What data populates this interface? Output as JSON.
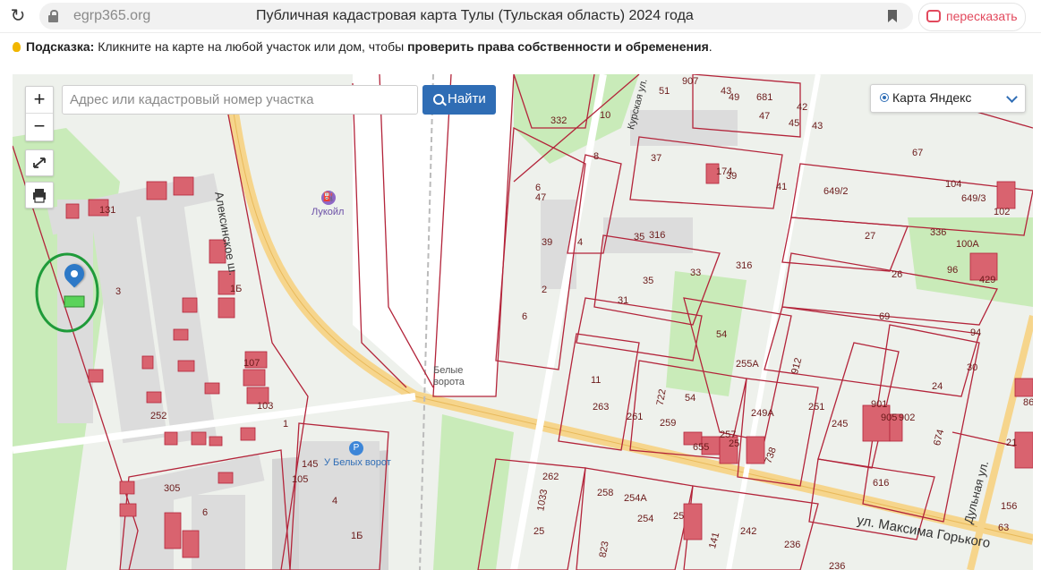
{
  "browser": {
    "domain": "egrp365.org",
    "page_title": "Публичная кадастровая карта Тулы (Тульская область) 2024 года",
    "retell_label": "пересказать"
  },
  "hint": {
    "label": "Подсказка:",
    "text": "Кликните на карте на любой участок или дом, чтобы",
    "bold": "проверить права собственности и обременения",
    "end": "."
  },
  "map": {
    "search_placeholder": "Адрес или кадастровый номер участка",
    "find_label": "Найти",
    "layer_label": "Карта Яндекс",
    "zoom_in": "+",
    "zoom_out": "−",
    "streets": {
      "aleksinskoe": "Алексинское ш.",
      "kurskaya": "Курская ул.",
      "maxim_gorkogo": "ул. Максима Горького",
      "dulnaya": "Дульная ул."
    },
    "pois": {
      "lukoil": "Лукойл",
      "belye_vorota": "Белые ворота",
      "u_belyh_vorot": "У Белых ворот"
    },
    "parcels": [
      "332",
      "10",
      "51",
      "907",
      "43",
      "49",
      "681",
      "47",
      "42",
      "45",
      "43",
      "67",
      "8",
      "37",
      "174",
      "39",
      "41",
      "649/2",
      "104",
      "649/3",
      "102",
      "6",
      "47",
      "131",
      "35",
      "316",
      "27",
      "336",
      "100А",
      "39",
      "4",
      "1Б",
      "3",
      "316",
      "26",
      "96",
      "429",
      "35",
      "33",
      "2",
      "31",
      "6",
      "69",
      "54",
      "94",
      "255А",
      "912",
      "30",
      "107",
      "11",
      "722",
      "24",
      "103",
      "263",
      "261",
      "259",
      "54",
      "249А",
      "251",
      "245",
      "901",
      "902",
      "905",
      "674",
      "252",
      "1",
      "655",
      "257",
      "25",
      "738",
      "616",
      "86",
      "21",
      "145",
      "105",
      "305",
      "1033",
      "262",
      "258",
      "254А",
      "254",
      "25",
      "6",
      "4",
      "1Б",
      "25",
      "823",
      "141",
      "242",
      "236",
      "156",
      "63",
      "236"
    ]
  },
  "colors": {
    "accent": "#2f6db5",
    "parcel_line": "#b3243a",
    "building_red": "#d9636f",
    "green_area": "#c9ebb9",
    "road": "#f6d58c",
    "highlight_circle": "#1f9b3a"
  }
}
